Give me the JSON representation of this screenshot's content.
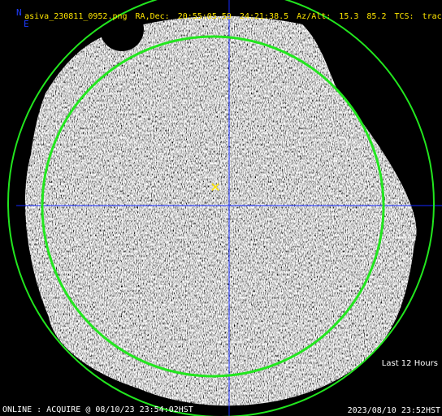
{
  "header": {
    "filename": "asiva_230811_0952.png",
    "radec_label": "RA,Dec:",
    "ra": "20:55:05.59",
    "dec": "24:21:38.5",
    "azalt_label": "Az/Alt:",
    "az": "15.3",
    "alt": "85.2",
    "tcs_label": "TCS:",
    "tcs": "track"
  },
  "compass": {
    "north": "N",
    "east": "E"
  },
  "overlay": {
    "duration_label": "Last 12 Hours",
    "status_text": "ONLINE : ACQUIRE @ 08/10/23 23:54:02HST",
    "timestamp": "2023/08/10 23:52HST"
  },
  "markers": {
    "target_symbol": "✕"
  },
  "colors": {
    "header_text": "#ffe600",
    "crosshair": "#1428ff",
    "circles": "#22e61e",
    "target_marker": "#ffe600",
    "compass": "#1e3cff"
  }
}
